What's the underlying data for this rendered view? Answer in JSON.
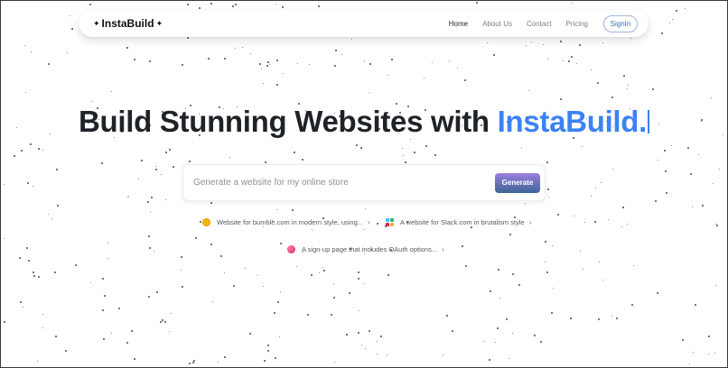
{
  "navbar": {
    "brand": "InstaBuild",
    "links": [
      {
        "label": "Home",
        "active": true
      },
      {
        "label": "About Us",
        "active": false
      },
      {
        "label": "Contact",
        "active": false
      },
      {
        "label": "Pricing",
        "active": false
      }
    ],
    "signin_label": "SignIn"
  },
  "hero": {
    "title_prefix": "Build Stunning Websites with",
    "title_accent": "InstaBuild."
  },
  "prompt": {
    "placeholder": "Generate a website for my online store",
    "value": "",
    "generate_label": "Generate"
  },
  "suggestions": [
    {
      "label": "Website for bumble.com in modern style, using...",
      "icon": "bumble-icon"
    },
    {
      "label": "A website for Slack.com in brutalism style",
      "icon": "slack-icon"
    },
    {
      "label": "A sign-up page that includes OAuth options...",
      "icon": "oauth-icon"
    }
  ],
  "colors": {
    "accent": "#3b82f6",
    "text_dark": "#1f2328",
    "nav_muted": "#7a7f87",
    "signin_text": "#3c6fb8",
    "generate_gradient_top": "#9a7fe0",
    "generate_gradient_bottom": "#3d6593"
  }
}
